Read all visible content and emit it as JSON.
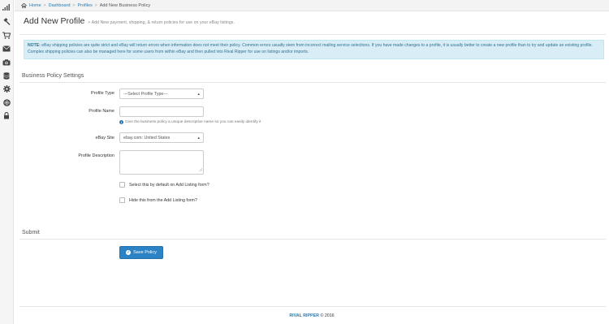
{
  "sidebar": {
    "icons": [
      "bar-chart-icon",
      "gavel-icon",
      "cart-icon",
      "envelope-icon",
      "camera-icon",
      "database-icon",
      "gear-icon",
      "lifebuoy-icon",
      "lock-icon"
    ]
  },
  "breadcrumb": {
    "home": "Home",
    "dashboard": "Dashboard",
    "profiles": "Profiles",
    "current": "Add New Business Policy",
    "separator": ">"
  },
  "header": {
    "title": "Add New Profile",
    "subtitle": "> Add New payment, shipping, & return policies for use on your eBay listings."
  },
  "note": {
    "label": "NOTE:",
    "text": " eBay shipping policies are quite strict and eBay will return errors when information does not meet their policy. Common errors usually stem from incorrect mailing service selections. If you have made changes to a profile, it is usually better to create a new profile than to try and update an existing profile. Complex shipping policies can also be managed here for some users from within eBay and then pulled into Rival Ripper for use on listings and/or imports."
  },
  "business_policy": {
    "section_title": "Business Policy Settings",
    "profile_type_label": "Profile Type",
    "profile_type_value": "---Select Profile Type---",
    "profile_name_label": "Profile Name",
    "profile_name_value": "",
    "profile_name_help": "Give the business policy a unique descriptive name so you can easily identify it",
    "ebay_site_label": "eBay Site",
    "ebay_site_value": "ebay.com: United States",
    "profile_description_label": "Profile Description",
    "profile_description_value": "",
    "default_checkbox_label": "Select this by default on Add Listing form?",
    "hide_checkbox_label": "Hide this from the Add Listing form?"
  },
  "submit": {
    "section_title": "Submit",
    "save_label": "Save Policy"
  },
  "footer": {
    "brand": "RIVAL RIPPER",
    "copyright": "© 2016"
  },
  "colors": {
    "accent": "#2b83c6",
    "note_bg": "#d9edf7",
    "note_text": "#31708f",
    "link": "#2a7ab0"
  }
}
